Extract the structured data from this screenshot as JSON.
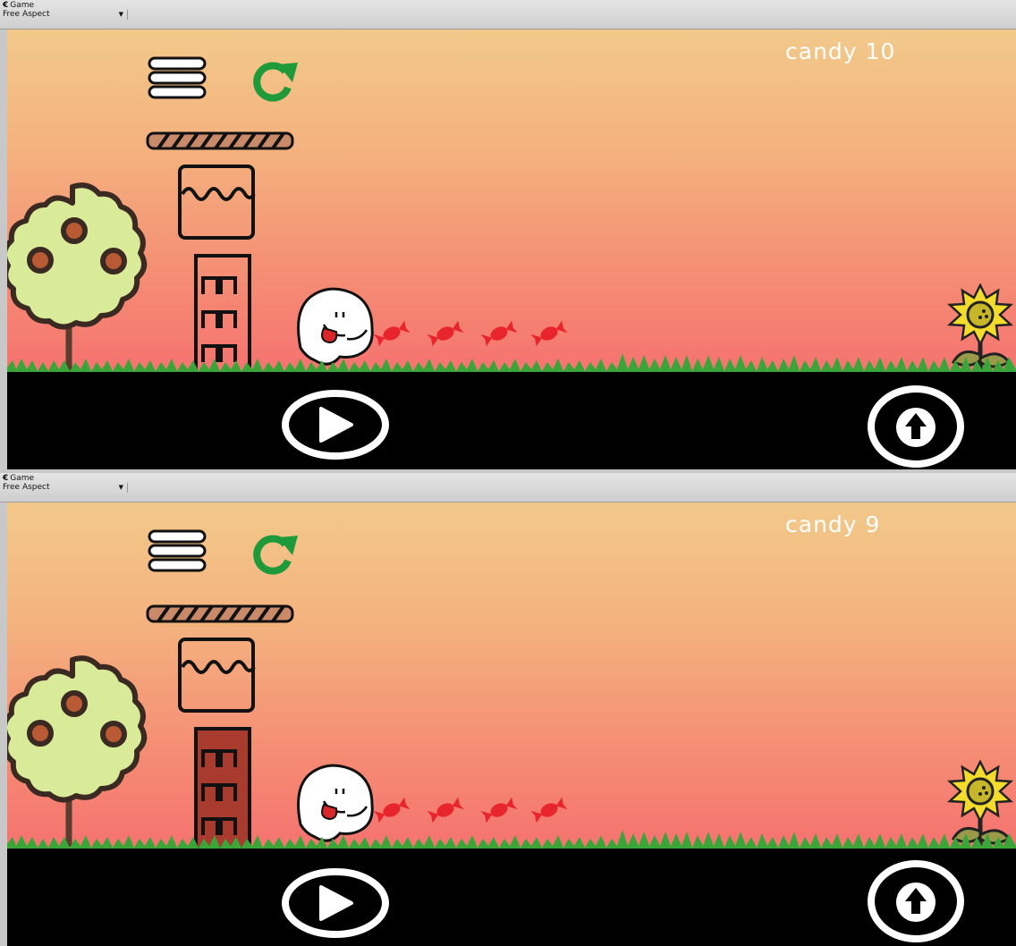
{
  "editor": {
    "window_title": "Game",
    "aspect_label": "Free Aspect"
  },
  "frames": [
    {
      "candy_label": "candy",
      "candy_count": "10",
      "door_state": "outline"
    },
    {
      "candy_label": "candy",
      "candy_count": "9",
      "door_state": "filled"
    }
  ],
  "colors": {
    "sky_top": "#f2c98a",
    "sky_bottom": "#f27571",
    "grass": "#3aa63a",
    "restart_green": "#1f9a3a",
    "candy_red": "#e8242c",
    "door_filled": "#a83a2e",
    "tree_leaves": "#d9eb98",
    "sunflower_petals": "#f3dc2c"
  },
  "icons": [
    "menu-icon",
    "restart-icon",
    "play-icon",
    "jump-arrow-icon",
    "game-window-icon"
  ]
}
